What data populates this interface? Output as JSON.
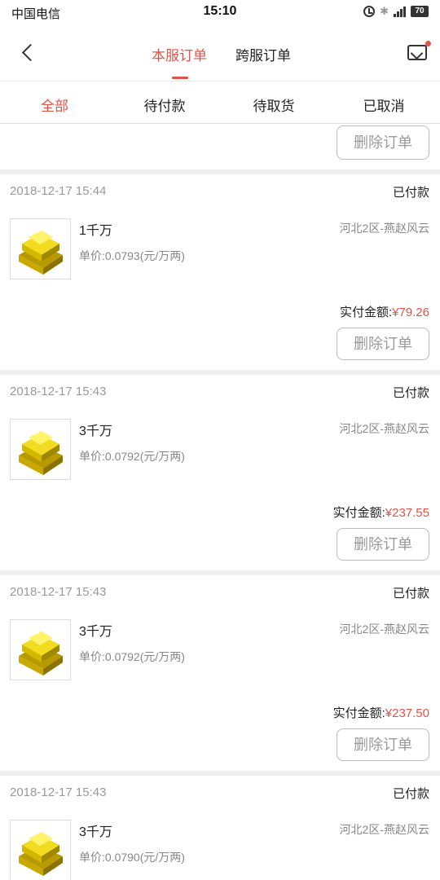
{
  "status_bar": {
    "carrier": "中国电信",
    "time": "15:10",
    "battery": "70",
    "network": "4G"
  },
  "nav": {
    "tabs": [
      {
        "label": "本服订单",
        "active": true
      },
      {
        "label": "跨服订单",
        "active": false
      }
    ]
  },
  "filters": [
    {
      "label": "全部",
      "active": true
    },
    {
      "label": "待付款",
      "active": false
    },
    {
      "label": "待取货",
      "active": false
    },
    {
      "label": "已取消",
      "active": false
    }
  ],
  "delete_label": "删除订单",
  "paid_label": "实付金额:",
  "colors": {
    "accent": "#e0544a",
    "gold": "#e8c800"
  },
  "orders": [
    {
      "time": "2018-12-17 15:44",
      "status": "已付款",
      "qty": "1千万",
      "server": "河北2区-燕赵风云",
      "unit_price": "单价:0.0793(元/万两)",
      "amount": "¥79.26"
    },
    {
      "time": "2018-12-17 15:43",
      "status": "已付款",
      "qty": "3千万",
      "server": "河北2区-燕赵风云",
      "unit_price": "单价:0.0792(元/万两)",
      "amount": "¥237.55"
    },
    {
      "time": "2018-12-17 15:43",
      "status": "已付款",
      "qty": "3千万",
      "server": "河北2区-燕赵风云",
      "unit_price": "单价:0.0792(元/万两)",
      "amount": "¥237.50"
    },
    {
      "time": "2018-12-17 15:43",
      "status": "已付款",
      "qty": "3千万",
      "server": "河北2区-燕赵风云",
      "unit_price": "单价:0.0790(元/万两)"
    }
  ]
}
